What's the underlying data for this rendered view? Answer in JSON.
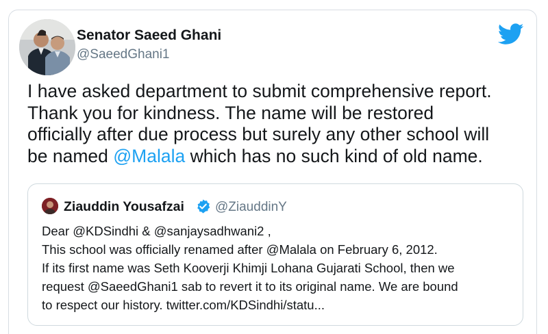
{
  "tweet": {
    "author_name": "Senator Saeed Ghani",
    "author_handle": "@SaeedGhani1",
    "avatar_icon": "profile-photo-two-men",
    "brand_icon": "twitter-bird-icon",
    "brand_color": "#1da1f2",
    "text_lines": [
      {
        "text": "I have asked department to submit comprehensive report."
      },
      {
        "text": "Thank you for kindness. The name will be restored"
      },
      {
        "text": "officially after due process but surely any other school will"
      },
      {
        "before": "be named ",
        "mention": "@Malala",
        "after": " which has no such kind of old name."
      }
    ]
  },
  "quoted_tweet": {
    "author_name": "Ziauddin Yousafzai",
    "author_handle": "@ZiauddinY",
    "verified_icon": "verified-badge-icon",
    "text_lines": [
      "Dear @KDSindhi & @sanjaysadhwani2 ,",
      "This school was officially renamed after @Malala on February 6, 2012.",
      "If its first name was Seth Kooverji Khimji Lohana Gujarati School, then we",
      "request @SaeedGhani1 sab to revert it to its original name. We are bound",
      "to respect our history. twitter.com/KDSindhi/statu..."
    ]
  }
}
